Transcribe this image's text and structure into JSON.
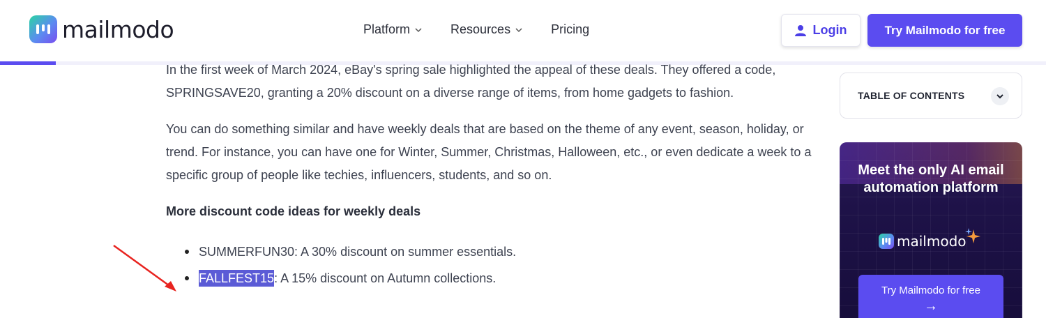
{
  "header": {
    "logo_text": "mailmodo",
    "nav": [
      {
        "label": "Platform",
        "has_dropdown": true
      },
      {
        "label": "Resources",
        "has_dropdown": true
      },
      {
        "label": "Pricing",
        "has_dropdown": false
      }
    ],
    "login_label": "Login",
    "cta_label": "Try Mailmodo for free",
    "reading_progress_fraction": 0.053
  },
  "article": {
    "paragraphs": [
      "In the first week of March 2024, eBay's spring sale highlighted the appeal of these deals. They offered a code, SPRINGSAVE20, granting a 20% discount on a diverse range of items, from home gadgets to fashion.",
      "You can do something similar and have weekly deals that are based on the theme of any event, season, holiday, or trend. For instance, you can have one for Winter, Summer, Christmas, Halloween, etc., or even dedicate a week to a specific group of people like techies, influencers, students, and so on."
    ],
    "subheading": "More discount code ideas for weekly deals",
    "list": [
      {
        "code": "SUMMERFUN30",
        "text": ": A 30% discount on summer essentials."
      },
      {
        "code": "FALLFEST15",
        "text": ": A 15% discount on Autumn collections.",
        "selected": true
      }
    ]
  },
  "sidebar": {
    "toc_label": "TABLE OF CONTENTS",
    "promo": {
      "title": "Meet the only AI email automation platform",
      "logo_text": "mailmodo",
      "button_label": "Try Mailmodo for free",
      "button_arrow": "→"
    }
  },
  "colors": {
    "brand": "#5b4cf0",
    "selection": "#5b5bd6",
    "annotation_arrow": "#e8231f"
  }
}
